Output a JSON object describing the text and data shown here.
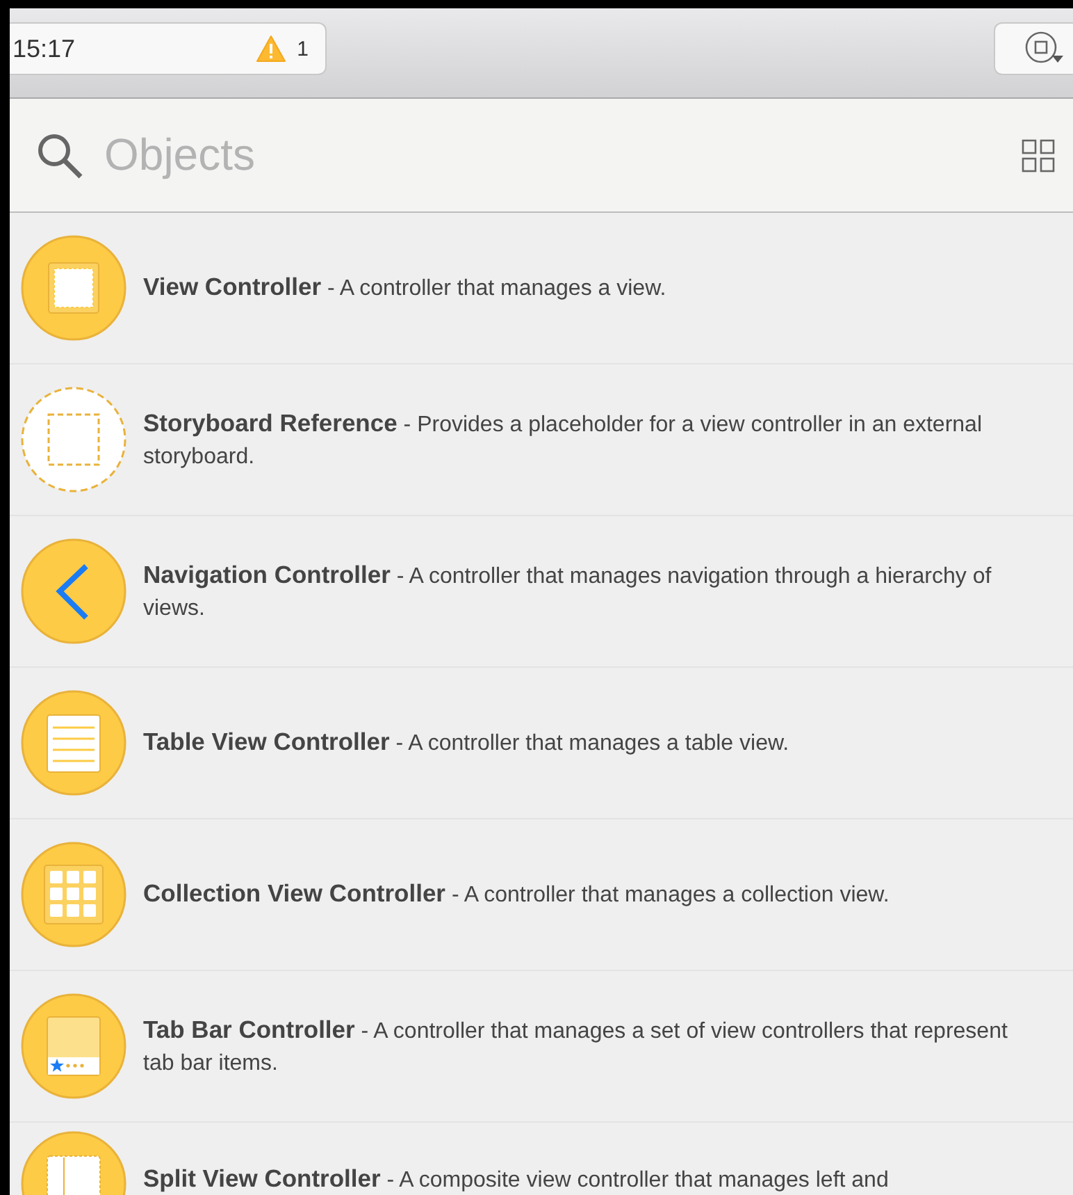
{
  "toolbar": {
    "status": {
      "time": "15:17",
      "warning_count": "1"
    }
  },
  "search": {
    "placeholder": "Objects"
  },
  "objects": [
    {
      "kind": "view",
      "text": "**View Controller** - A controller that manages a view."
    },
    {
      "kind": "storyboard",
      "text": "**Storyboard Reference** - Provides a placeholder for a view controller in an external storyboard."
    },
    {
      "kind": "navigation",
      "text": "**Navigation Controller** - A controller that manages navigation through a hierarchy of views."
    },
    {
      "kind": "table",
      "text": "**Table View Controller** - A controller that manages a table view."
    },
    {
      "kind": "collection",
      "text": "**Collection View Controller** - A controller that manages a collection view."
    },
    {
      "kind": "tabbar",
      "text": "**Tab Bar Controller** - A controller that manages a set of view controllers that represent tab bar items."
    },
    {
      "kind": "split",
      "text": "**Split View Controller** - A composite view controller that manages left and"
    }
  ]
}
